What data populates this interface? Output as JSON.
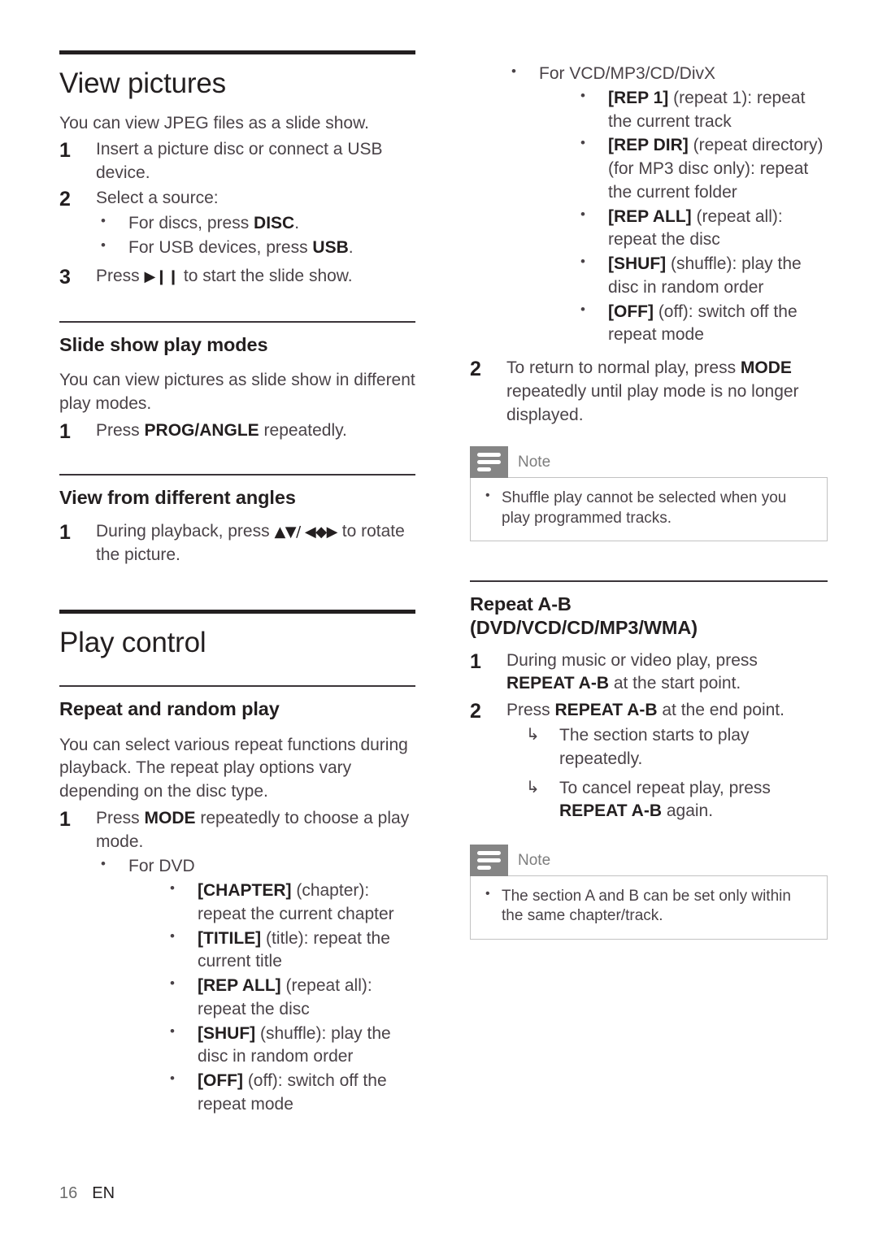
{
  "footer": {
    "page_number": "16",
    "language": "EN"
  },
  "left_column": {
    "section1": {
      "title": "View pictures",
      "intro": "You can view JPEG files as a slide show.",
      "steps": [
        {
          "num": "1",
          "text_before": "Insert a picture disc or connect a USB device.",
          "text_after": ""
        },
        {
          "num": "2",
          "text_before": "Select a source:",
          "text_after": ""
        },
        {
          "num": "3",
          "text_before": "Press ",
          "glyph": "▶❙❙",
          "text_after": " to start the slide show."
        }
      ],
      "step2_bullets": [
        {
          "text_before": "For discs, press ",
          "bold": "DISC",
          "text_after": "."
        },
        {
          "text_before": "For USB devices, press ",
          "bold": "USB",
          "text_after": "."
        }
      ]
    },
    "section2": {
      "title": "Slide show play modes",
      "intro": "You can view pictures as slide show in different play modes.",
      "step": {
        "num": "1",
        "text_before": "Press ",
        "bold": "PROG/ANGLE",
        "text_after": " repeatedly."
      }
    },
    "section3": {
      "title": "View from different angles",
      "step": {
        "num": "1",
        "text_before": "During playback, press ",
        "glyph": "▲▼/ ◀◆▶",
        "text_after": " to rotate the picture."
      }
    },
    "section4": {
      "title": "Play control",
      "subtitle": "Repeat and random play",
      "intro": "You can select various repeat functions during playback. The repeat play options vary depending on the disc type.",
      "step": {
        "num": "1",
        "text_before": "Press ",
        "bold": "MODE",
        "text_after": " repeatedly to choose a play mode."
      },
      "group_label": "For DVD",
      "modes": [
        {
          "code": "[CHAPTER]",
          "desc": " (chapter): repeat the current chapter"
        },
        {
          "code": "[TITILE]",
          "desc": " (title): repeat the current title"
        },
        {
          "code": "[REP ALL]",
          "desc": " (repeat all): repeat the disc"
        },
        {
          "code": "[SHUF]",
          "desc": " (shuffle): play the disc in random order"
        },
        {
          "code": "[OFF]",
          "desc": " (off): switch off the repeat mode"
        }
      ]
    }
  },
  "right_column": {
    "continued_list": {
      "group_label": "For VCD/MP3/CD/DivX",
      "modes": [
        {
          "code": "[REP 1]",
          "desc": " (repeat 1): repeat the current track"
        },
        {
          "code": "[REP DIR]",
          "desc": " (repeat directory) (for MP3 disc only): repeat the current folder"
        },
        {
          "code": "[REP ALL]",
          "desc": " (repeat all): repeat the disc"
        },
        {
          "code": "[SHUF]",
          "desc": " (shuffle): play the disc in random order"
        },
        {
          "code": "[OFF]",
          "desc": " (off): switch off the repeat mode"
        }
      ]
    },
    "step2": {
      "num": "2",
      "text_before": "To return to normal play, press ",
      "bold": "MODE",
      "text_after": " repeatedly until play mode is no longer displayed."
    },
    "note1": {
      "title": "Note",
      "items": [
        "Shuffle play cannot be selected when you play programmed tracks."
      ]
    },
    "section_repeat_ab": {
      "title": "Repeat A-B (DVD/VCD/CD/MP3/WMA)",
      "steps": [
        {
          "num": "1",
          "text_before": "During music or video play, press ",
          "bold": "REPEAT A-B",
          "text_after": " at the start point."
        },
        {
          "num": "2",
          "text_before": "Press ",
          "bold": "REPEAT A-B",
          "text_after": " at the end point."
        }
      ],
      "results": [
        {
          "arrow": "↳",
          "text_before": "The section starts to play repeatedly.",
          "bold": "",
          "text_after": ""
        },
        {
          "arrow": "↳",
          "text_before": "To cancel repeat play, press ",
          "bold": "REPEAT A-B",
          "text_after": " again."
        }
      ]
    },
    "note2": {
      "title": "Note",
      "items": [
        "The section A and B can be set only within the same chapter/track."
      ]
    }
  }
}
